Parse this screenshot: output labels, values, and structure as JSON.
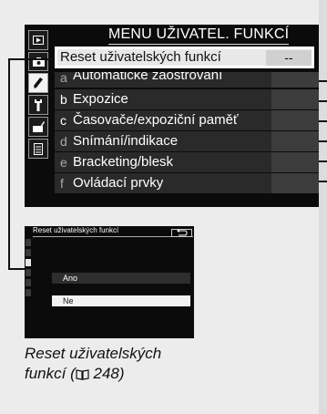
{
  "top_screen": {
    "title": "MENU UŽIVATEL. FUNKCÍ",
    "selected_item": {
      "label": "Reset uživatelských funkcí",
      "value": "--"
    },
    "items": [
      {
        "letter": "a",
        "label": "Automatické zaostřování"
      },
      {
        "letter": "b",
        "label": "Expozice"
      },
      {
        "letter": "c",
        "label": "Časovače/expoziční paměť"
      },
      {
        "letter": "d",
        "label": "Snímání/indikace"
      },
      {
        "letter": "e",
        "label": "Bracketing/blesk"
      },
      {
        "letter": "f",
        "label": "Ovládací prvky"
      }
    ],
    "sidebar_icons": [
      "playback-icon",
      "camera-icon",
      "pencil-icon",
      "wrench-icon",
      "retouch-icon",
      "my-menu-icon"
    ]
  },
  "bottom_screen": {
    "title": "Reset uživatelských funkcí",
    "options": [
      "Ano",
      "Ne"
    ],
    "selected_option": "Ne"
  },
  "caption": {
    "line1": "Reset uživatelských",
    "line2_text": "funkcí (",
    "page_ref": "248",
    "line2_end": ")"
  }
}
